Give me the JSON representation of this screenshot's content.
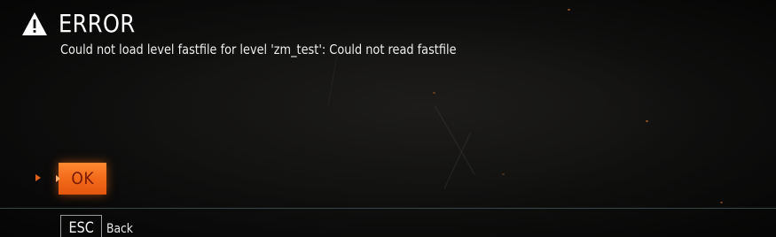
{
  "dialog": {
    "title": "ERROR",
    "message": "Could not load level fastfile for level 'zm_test': Could not read fastfile",
    "icon": "warning-icon"
  },
  "actions": {
    "ok_label": "OK"
  },
  "footer": {
    "key_label": "ESC",
    "key_action": "Back"
  },
  "colors": {
    "accent": "#f26a1a",
    "ok_text": "#7a1a00",
    "background": "#121211",
    "divider": "#3d4548"
  }
}
